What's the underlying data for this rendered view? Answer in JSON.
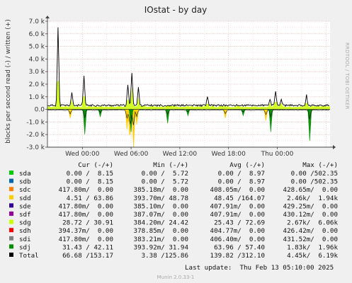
{
  "colors": {
    "sda": "#00cc00",
    "sdb": "#0066b3",
    "sdc": "#ff8000",
    "sdd": "#ffcc00",
    "sde": "#330099",
    "sdf": "#990099",
    "sdg": "#ccff00",
    "sdh": "#ff0000",
    "sdi": "#808080",
    "sdj": "#008f00",
    "Total": "#000000",
    "background": "#f0f0f0",
    "plot_background": "#ffffff",
    "grid": "#e8b0b0"
  },
  "chart_data": {
    "type": "line",
    "title": "IOstat - by day",
    "ylabel": "blocks per second read (-) / written (+)",
    "ylim": [
      -3000,
      7000
    ],
    "yticks": [
      -3000,
      -2000,
      -1000,
      0,
      1000,
      2000,
      3000,
      4000,
      5000,
      6000,
      7000
    ],
    "ytick_labels": [
      "-3.0 k",
      "-2.0 k",
      "-1.0 k",
      "0.0",
      "1.0 k",
      "2.0 k",
      "3.0 k",
      "4.0 k",
      "5.0 k",
      "6.0 k",
      "7.0 k"
    ],
    "x_range_hours": [
      -4.3,
      30.5
    ],
    "xticks": [
      {
        "hour": 0,
        "label": "Wed 00:00"
      },
      {
        "hour": 6,
        "label": "Wed 06:00"
      },
      {
        "hour": 12,
        "label": "Wed 12:00"
      },
      {
        "hour": 18,
        "label": "Wed 18:00"
      },
      {
        "hour": 24,
        "label": "Thu 00:00"
      }
    ],
    "series": [
      {
        "name": "Total",
        "write_spikes": [
          {
            "hour": -3.0,
            "value": 6190
          },
          {
            "hour": -1.3,
            "value": 1000
          },
          {
            "hour": 0.2,
            "value": 2300
          },
          {
            "hour": 5.6,
            "value": 1600
          },
          {
            "hour": 6.1,
            "value": 2600
          },
          {
            "hour": 6.9,
            "value": 1400
          },
          {
            "hour": 15.4,
            "value": 650
          },
          {
            "hour": 23.1,
            "value": 500
          },
          {
            "hour": 23.8,
            "value": 1100
          },
          {
            "hour": 24.5,
            "value": 450
          },
          {
            "hour": 27.6,
            "value": 800
          }
        ],
        "baseline_write": 300
      },
      {
        "name": "sdd",
        "read_spikes": [
          {
            "hour": -1.5,
            "value": -700
          },
          {
            "hour": 5.5,
            "value": -1600
          },
          {
            "hour": 5.85,
            "value": -2600
          },
          {
            "hour": 6.3,
            "value": -3000
          },
          {
            "hour": 6.7,
            "value": -1200
          },
          {
            "hour": 17.6,
            "value": -700
          },
          {
            "hour": 22.6,
            "value": -900
          }
        ]
      },
      {
        "name": "sdj",
        "read_spikes": [
          {
            "hour": 0.3,
            "value": -2000
          },
          {
            "hour": 2.2,
            "value": -600
          },
          {
            "hour": 6.0,
            "value": -1800
          },
          {
            "hour": 10.5,
            "value": -1100
          },
          {
            "hour": 13.0,
            "value": -500
          },
          {
            "hour": 19.8,
            "value": -500
          },
          {
            "hour": 23.2,
            "value": -1800
          },
          {
            "hour": 28.0,
            "value": -2500
          }
        ]
      }
    ]
  },
  "side_label": "RRDTOOL / TOBI OETIKER",
  "legend": {
    "headers": [
      "Cur (-/+)",
      "Min (-/+)",
      "Avg (-/+)",
      "Max (-/+)"
    ],
    "rows": [
      {
        "name": "sda",
        "cur": "0.00 /  8.15",
        "min": "0.00 /  5.72",
        "avg": "0.00 /  8.97",
        "max": "0.00 /502.35"
      },
      {
        "name": "sdb",
        "cur": "0.00 /  8.15",
        "min": "0.00 /  5.72",
        "avg": "0.00 /  8.97",
        "max": "0.00 /502.35"
      },
      {
        "name": "sdc",
        "cur": "417.80m/  0.00",
        "min": "385.18m/  0.00",
        "avg": "408.05m/  0.00",
        "max": "428.65m/  0.00"
      },
      {
        "name": "sdd",
        "cur": "4.51 / 63.86",
        "min": "393.70m/ 48.78",
        "avg": "48.45 /164.07",
        "max": "2.46k/  1.94k"
      },
      {
        "name": "sde",
        "cur": "417.80m/  0.00",
        "min": "385.10m/  0.00",
        "avg": "407.91m/  0.00",
        "max": "429.25m/  0.00"
      },
      {
        "name": "sdf",
        "cur": "417.80m/  0.00",
        "min": "387.07m/  0.00",
        "avg": "407.91m/  0.00",
        "max": "430.12m/  0.00"
      },
      {
        "name": "sdg",
        "cur": "28.72 / 30.91",
        "min": "384.20m/ 24.42",
        "avg": "25.43 / 72.69",
        "max": "2.67k/  6.06k"
      },
      {
        "name": "sdh",
        "cur": "394.37m/  0.00",
        "min": "378.85m/  0.00",
        "avg": "404.77m/  0.00",
        "max": "426.42m/  0.00"
      },
      {
        "name": "sdi",
        "cur": "417.80m/  0.00",
        "min": "383.21m/  0.00",
        "avg": "406.40m/  0.00",
        "max": "431.52m/  0.00"
      },
      {
        "name": "sdj",
        "cur": "31.43 / 42.11",
        "min": "393.92m/ 31.94",
        "avg": "63.96 / 57.40",
        "max": "1.83k/  1.96k"
      },
      {
        "name": "Total",
        "cur": "66.68 /153.17",
        "min": "3.38 /125.86",
        "avg": "139.82 /312.10",
        "max": "4.45k/  6.19k"
      }
    ]
  },
  "last_update": "Last update:  Thu Feb 13 05:10:00 2025",
  "footer": "Munin 2.0.33-1"
}
